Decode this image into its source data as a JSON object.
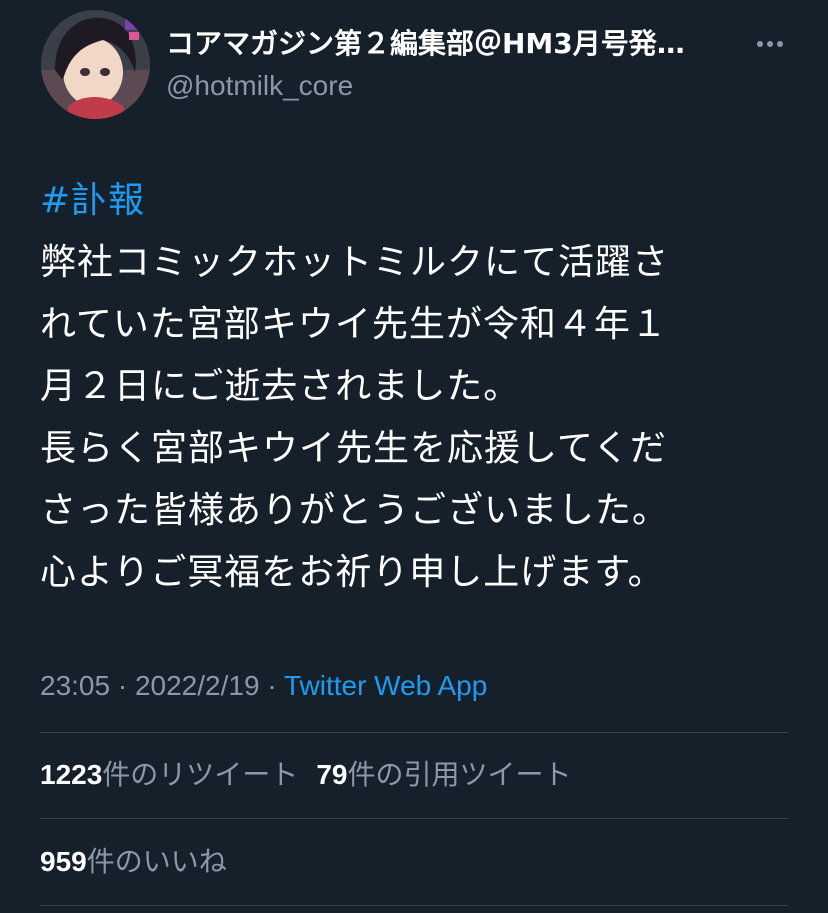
{
  "user": {
    "display_name": "コアマガジン第２編集部＠HM3月号発…",
    "handle": "@hotmilk_core"
  },
  "tweet": {
    "hashtag": "#訃報",
    "lines": [
      "弊社コミックホットミルクにて活躍さ",
      "れていた宮部キウイ先生が令和４年１",
      "月２日にご逝去されました。",
      "長らく宮部キウイ先生を応援してくだ",
      "さった皆様ありがとうございました。",
      "心よりご冥福をお祈り申し上げます。"
    ]
  },
  "meta": {
    "time": "23:05",
    "separator": " · ",
    "date": "2022/2/19",
    "source": "Twitter Web App"
  },
  "stats": {
    "retweets_count": "1223",
    "retweets_label": "件のリツイート",
    "quotes_count": "79",
    "quotes_label": "件の引用ツイート",
    "likes_count": "959",
    "likes_label": "件のいいね"
  },
  "colors": {
    "background": "#15202b",
    "link": "#1d9bf0",
    "secondary_text": "#8b98a5",
    "divider": "#38444d"
  },
  "icons": {
    "more": "more-horizontal-icon"
  }
}
